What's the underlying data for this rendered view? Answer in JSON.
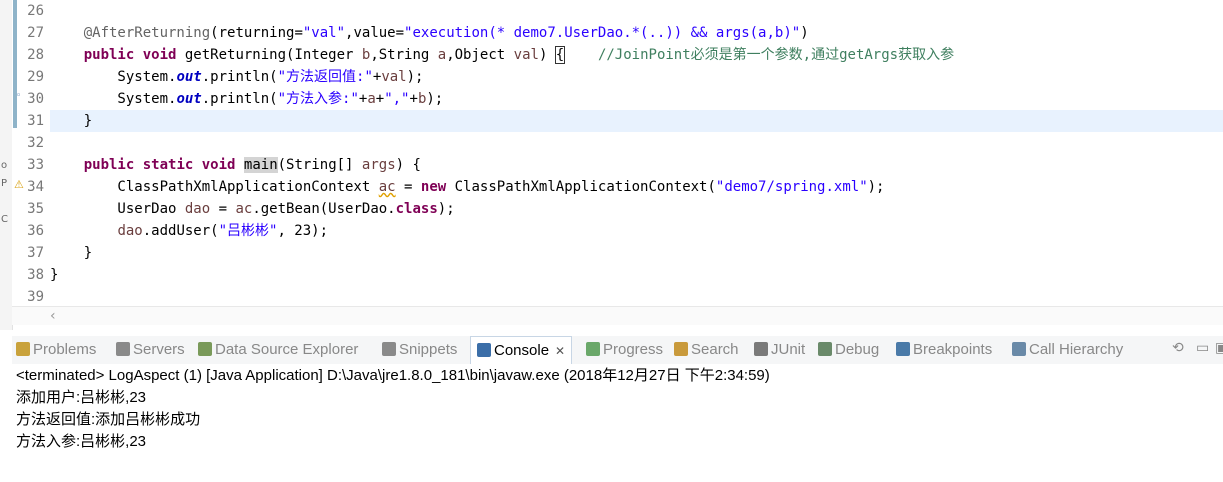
{
  "editor": {
    "lines": [
      {
        "num": "26",
        "html": ""
      },
      {
        "num": "27",
        "html": "    <span class=\"ann\">@AfterReturning</span>(returning=<span class=\"str\">\"val\"</span>,value=<span class=\"str\">\"execution(* demo7.UserDao.*(..)) &amp;&amp; args(a,b)\"</span>)"
      },
      {
        "num": "28",
        "html": "    <span class=\"kw\">public</span> <span class=\"kw\">void</span> getReturning(Integer <span class=\"var\">b</span>,String <span class=\"var\">a</span>,Object <span class=\"var\">val</span>) <span class=\"brace\">{</span>    <span class=\"cmt\">//JoinPoint必须是第一个参数,通过getArgs获取入参</span>"
      },
      {
        "num": "29",
        "html": "        System.<span class=\"fld\">out</span>.println(<span class=\"str\">\"方法返回值:\"</span>+<span class=\"var\">val</span>);"
      },
      {
        "num": "30",
        "html": "        System.<span class=\"fld\">out</span>.println(<span class=\"str\">\"方法入参:\"</span>+<span class=\"var\">a</span>+<span class=\"str\">\",\"</span>+<span class=\"var\">b</span>);"
      },
      {
        "num": "31",
        "html": "    }"
      },
      {
        "num": "32",
        "html": ""
      },
      {
        "num": "33",
        "html": "    <span class=\"kw\">public</span> <span class=\"kw\">static</span> <span class=\"kw\">void</span> <span class=\"hl\">main</span>(String[] <span class=\"var\">args</span>) {"
      },
      {
        "num": "34",
        "html": "        ClassPathXmlApplicationContext <span class=\"var\" style=\"text-decoration:underline wavy #e0a000;\">ac</span> = <span class=\"kw\">new</span> ClassPathXmlApplicationContext(<span class=\"str\">\"demo7/spring.xml\"</span>);"
      },
      {
        "num": "35",
        "html": "        UserDao <span class=\"var\">dao</span> = <span class=\"var\">ac</span>.getBean(UserDao.<span class=\"kw\">class</span>);"
      },
      {
        "num": "36",
        "html": "        <span class=\"var\">dao</span>.addUser(<span class=\"str\">\"吕彬彬\"</span>, 23);"
      },
      {
        "num": "37",
        "html": "    }"
      },
      {
        "num": "38",
        "html": "}"
      },
      {
        "num": "39",
        "html": ""
      }
    ]
  },
  "views": {
    "tabs": [
      {
        "label": "Problems",
        "icon": "problems-icon",
        "color": "#c9a23c"
      },
      {
        "label": "Servers",
        "icon": "servers-icon",
        "color": "#8a8a8a"
      },
      {
        "label": "Data Source Explorer",
        "icon": "database-icon",
        "color": "#7a9a5a"
      },
      {
        "label": "Snippets",
        "icon": "snippets-icon",
        "color": "#8a8a8a"
      },
      {
        "label": "Console",
        "icon": "console-icon",
        "color": "#3b6ea8"
      },
      {
        "label": "Progress",
        "icon": "progress-icon",
        "color": "#6aa86a"
      },
      {
        "label": "Search",
        "icon": "search-icon",
        "color": "#c99a3c"
      },
      {
        "label": "JUnit",
        "icon": "junit-icon",
        "color": "#7a7a7a"
      },
      {
        "label": "Debug",
        "icon": "debug-icon",
        "color": "#6a8a6a"
      },
      {
        "label": "Breakpoints",
        "icon": "breakpoints-icon",
        "color": "#4a7aa8"
      },
      {
        "label": "Call Hierarchy",
        "icon": "call-hierarchy-icon",
        "color": "#6a8aa8"
      }
    ],
    "close_glyph": "✕"
  },
  "console": {
    "status": "<terminated> LogAspect (1) [Java Application] D:\\Java\\jre1.8.0_181\\bin\\javaw.exe (2018年12月27日 下午2:34:59)",
    "output": [
      "添加用户:吕彬彬,23",
      "方法返回值:添加吕彬彬成功",
      "方法入参:吕彬彬,23"
    ]
  }
}
